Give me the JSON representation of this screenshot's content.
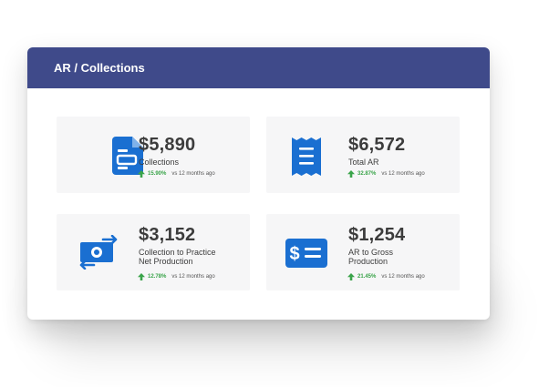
{
  "header": {
    "title": "AR / Collections"
  },
  "colors": {
    "header_bg": "#3f4a8a",
    "icon_blue": "#1a6fd1",
    "trend_green": "#3aa44a"
  },
  "tiles": [
    {
      "icon": "document-icon",
      "value": "$5,890",
      "label_line1": "Collections",
      "label_line2": "",
      "pct": "15.90%",
      "compare": "vs 12 months ago"
    },
    {
      "icon": "receipt-icon",
      "value": "$6,572",
      "label_line1": "Total AR",
      "label_line2": "",
      "pct": "32.87%",
      "compare": "vs 12 months ago"
    },
    {
      "icon": "money-transfer-icon",
      "value": "$3,152",
      "label_line1": "Collection to Practice",
      "label_line2": "Net Production",
      "pct": "12.78%",
      "compare": "vs 12 months ago"
    },
    {
      "icon": "dollar-list-icon",
      "value": "$1,254",
      "label_line1": "AR to Gross",
      "label_line2": "Production",
      "pct": "21.45%",
      "compare": "vs 12 months ago"
    }
  ]
}
